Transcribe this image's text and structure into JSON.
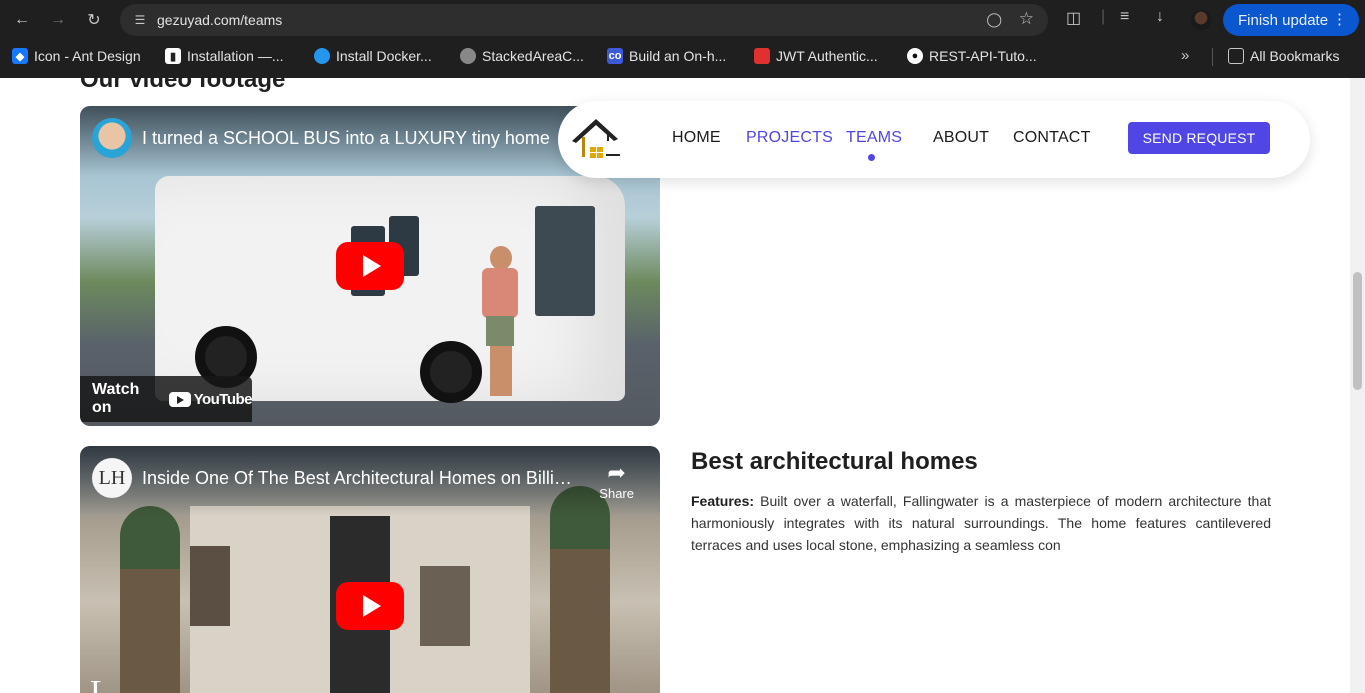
{
  "browser": {
    "url": "gezuyad.com/teams",
    "finish_update_label": "Finish update",
    "bookmarks": [
      {
        "label": "Icon - Ant Design",
        "color": "#1677ff"
      },
      {
        "label": "Installation —...",
        "color": "#ffffff"
      },
      {
        "label": "Install Docker...",
        "color": "#2496ed"
      },
      {
        "label": "StackedAreaC...",
        "color": "#888888"
      },
      {
        "label": "Build an On-h...",
        "color": "#3b5bdb"
      },
      {
        "label": "JWT Authentic...",
        "color": "#e03131"
      },
      {
        "label": "REST-API-Tuto...",
        "color": "#ffffff"
      }
    ],
    "all_bookmarks_label": "All Bookmarks"
  },
  "page": {
    "section_title": "Our video footage",
    "nav": {
      "links": [
        "HOME",
        "PROJECTS",
        "TEAMS",
        "ABOUT",
        "CONTACT"
      ],
      "active": "TEAMS",
      "cta": "SEND REQUEST",
      "accent_color": "#4f46e5"
    },
    "videos": [
      {
        "title": "I turned a SCHOOL BUS into a LUXURY tiny home",
        "watch_on": "Watch on",
        "youtube_label": "YouTube"
      },
      {
        "title": "Inside One Of The Best Architectural Homes on Billio...",
        "share_label": "Share",
        "channel_initials": "LH"
      }
    ],
    "article": {
      "title": "Best architectural homes",
      "features_label": "Features:",
      "features_text": " Built over a waterfall, Fallingwater is a masterpiece of modern architecture that harmoniously integrates with its natural surroundings. The home features cantilevered terraces and uses local stone, emphasizing a seamless con"
    }
  }
}
